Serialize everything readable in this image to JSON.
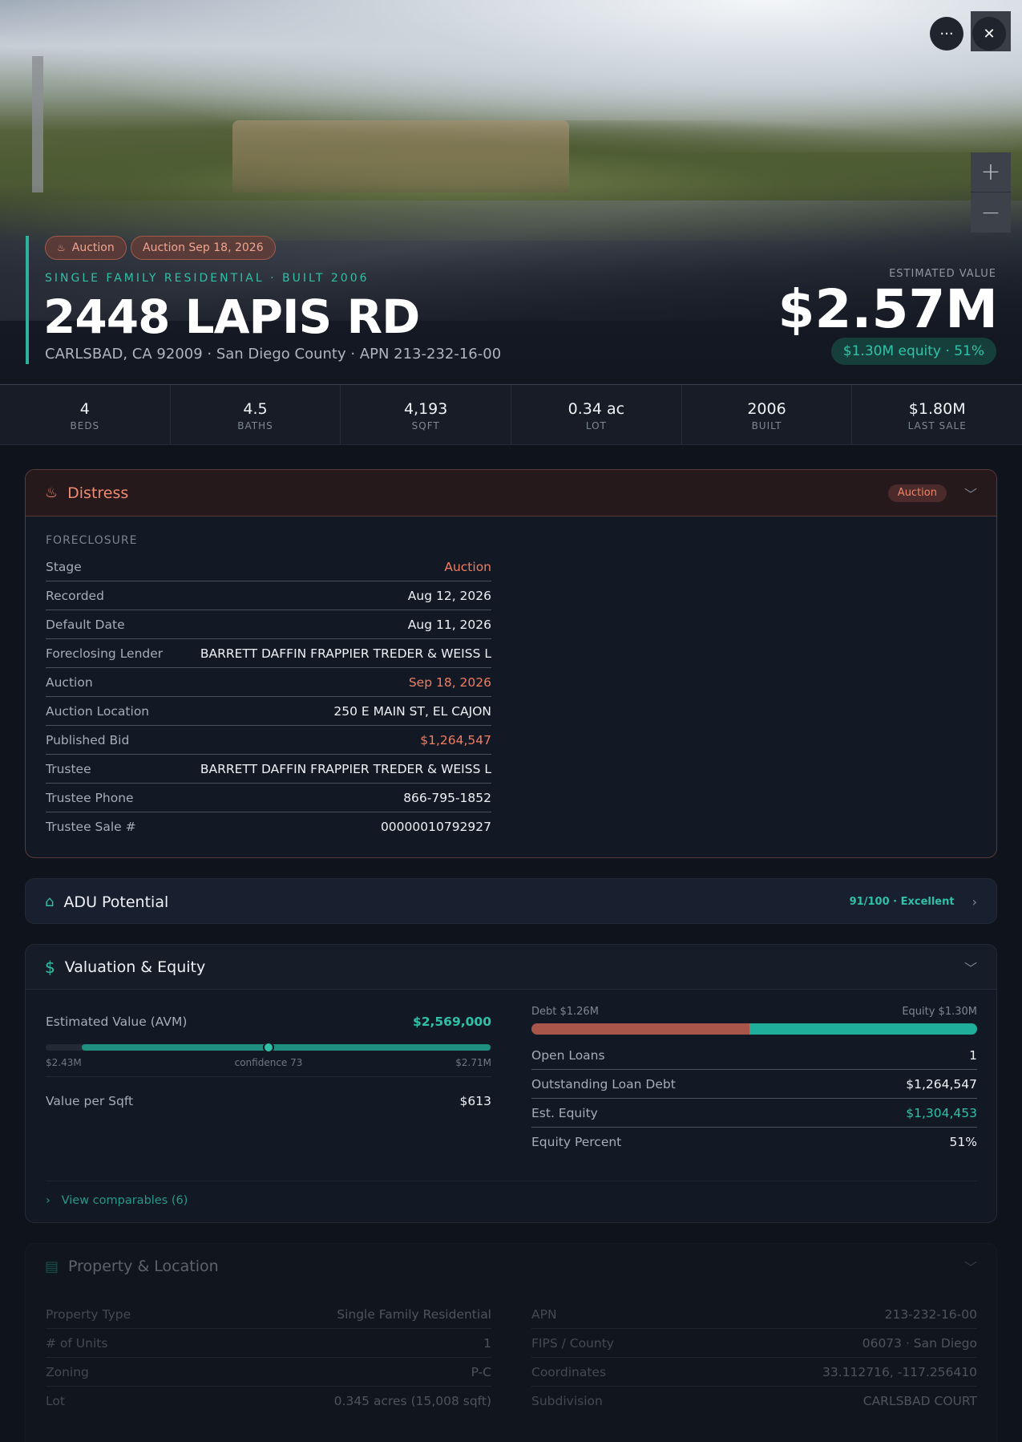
{
  "hero": {
    "badge_auction": "Auction",
    "badge_auction_date": "Auction Sep 18, 2026",
    "subtitle": "SINGLE FAMILY RESIDENTIAL · BUILT 2006",
    "address": "2448 LAPIS RD",
    "location": "CARLSBAD, CA 92009 · San Diego County · APN 213-232-16-00",
    "estimated_label": "ESTIMATED VALUE",
    "estimated_value": "$2.57M",
    "equity_pill": "$1.30M equity · 51%",
    "more_icon": "···",
    "close_icon": "✕",
    "zoom_in": "+",
    "zoom_out": "−"
  },
  "stats": [
    {
      "value": "4",
      "label": "BEDS"
    },
    {
      "value": "4.5",
      "label": "BATHS"
    },
    {
      "value": "4,193",
      "label": "SQFT"
    },
    {
      "value": "0.34 ac",
      "label": "LOT"
    },
    {
      "value": "2006",
      "label": "BUILT"
    },
    {
      "value": "$1.80M",
      "label": "LAST SALE"
    }
  ],
  "distress": {
    "title": "Distress",
    "badge": "Auction",
    "section_label": "FORECLOSURE",
    "rows": [
      {
        "k": "Stage",
        "v": "Auction"
      },
      {
        "k": "Recorded",
        "v": "Aug 12, 2026"
      },
      {
        "k": "Default Date",
        "v": "Aug 11, 2026"
      },
      {
        "k": "Foreclosing Lender",
        "v": "BARRETT DAFFIN FRAPPIER TREDER & WEISS L"
      },
      {
        "k": "Auction",
        "v": "Sep 18, 2026"
      },
      {
        "k": "Auction Location",
        "v": "250 E MAIN ST, EL CAJON"
      },
      {
        "k": "Published Bid",
        "v": "$1,264,547"
      },
      {
        "k": "Trustee",
        "v": "BARRETT DAFFIN FRAPPIER TREDER & WEISS L"
      },
      {
        "k": "Trustee Phone",
        "v": "866-795-1852"
      },
      {
        "k": "Trustee Sale #",
        "v": "00000010792927"
      }
    ]
  },
  "adu": {
    "title": "ADU Potential",
    "score": "91/100 · Excellent"
  },
  "valuation": {
    "title": "Valuation & Equity",
    "avm_label": "Estimated Value (AVM)",
    "avm_value": "$2,569,000",
    "range_low": "$2.43M",
    "range_mid": "confidence 73",
    "range_high": "$2.71M",
    "vps_label": "Value per Sqft",
    "vps_value": "$613",
    "debt_label": "Debt $1.26M",
    "equity_label": "Equity $1.30M",
    "equity_fraction": 0.51,
    "rows": [
      {
        "k": "Open Loans",
        "v": "1"
      },
      {
        "k": "Outstanding Loan Debt",
        "v": "$1,264,547"
      },
      {
        "k": "Est. Equity",
        "v": "$1,304,453"
      },
      {
        "k": "Equity Percent",
        "v": "51%"
      }
    ],
    "comps_link": "View comparables (6)"
  },
  "property": {
    "title": "Property & Location",
    "left_rows": [
      {
        "k": "Property Type",
        "v": "Single Family Residential"
      },
      {
        "k": "# of Units",
        "v": "1"
      },
      {
        "k": "Zoning",
        "v": "P-C"
      },
      {
        "k": "Lot",
        "v": "0.345 acres (15,008 sqft)"
      }
    ],
    "right_rows": [
      {
        "k": "APN",
        "v": "213-232-16-00"
      },
      {
        "k": "FIPS / County",
        "v": "06073 · San Diego"
      },
      {
        "k": "Coordinates",
        "v": "33.112716, -117.256410"
      },
      {
        "k": "Subdivision",
        "v": "CARLSBAD COURT"
      }
    ]
  }
}
